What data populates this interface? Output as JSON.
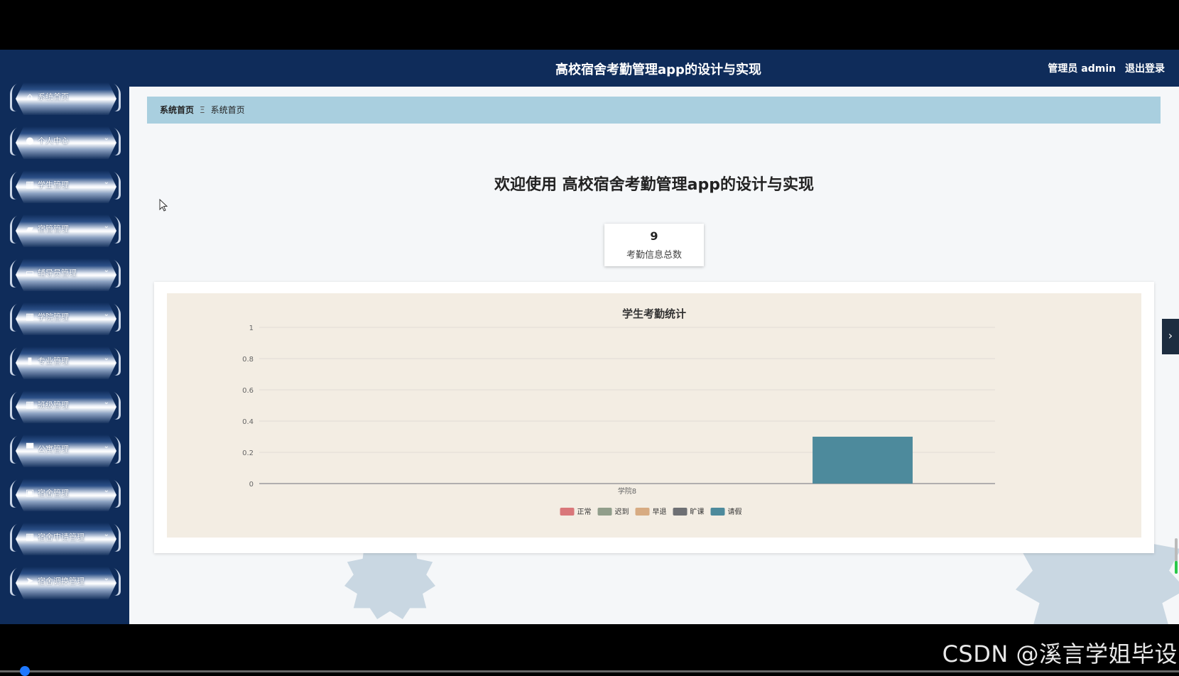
{
  "header": {
    "title": "高校宿舍考勤管理app的设计与实现",
    "user": "管理员 admin",
    "logout": "退出登录"
  },
  "sidebar": {
    "items": [
      {
        "label": "系统首页",
        "icon": "home-icon",
        "arrow": false
      },
      {
        "label": "个人中心",
        "icon": "user-icon",
        "arrow": true
      },
      {
        "label": "学生管理",
        "icon": "grid-icon",
        "arrow": true
      },
      {
        "label": "宿管管理",
        "icon": "briefcase-icon",
        "arrow": true
      },
      {
        "label": "辅导员管理",
        "icon": "monitor-icon",
        "arrow": true
      },
      {
        "label": "学院管理",
        "icon": "grid-icon",
        "arrow": true
      },
      {
        "label": "专业管理",
        "icon": "bar-chart-icon",
        "arrow": true
      },
      {
        "label": "班级管理",
        "icon": "grid-icon",
        "arrow": true
      },
      {
        "label": "公寓管理",
        "icon": "desk-icon",
        "arrow": true
      },
      {
        "label": "宿舍管理",
        "icon": "clipboard-icon",
        "arrow": true
      },
      {
        "label": "宿舍申请管理",
        "icon": "grid-icon",
        "arrow": true
      },
      {
        "label": "宿舍调换管理",
        "icon": "send-icon",
        "arrow": true
      }
    ]
  },
  "breadcrumb": {
    "home": "系统首页",
    "separator": "Ξ",
    "current": "系统首页"
  },
  "main": {
    "welcome": "欢迎使用 高校宿舍考勤管理app的设计与实现",
    "stat": {
      "value": "9",
      "label": "考勤信息总数"
    }
  },
  "watermark": "CSDN @溪言学姐毕设",
  "colors": {
    "navy": "#0f2c5a",
    "breadcrumb_bg": "#a9cfdf",
    "chart_bg": "#f3ede3"
  },
  "chart_data": {
    "type": "bar",
    "title": "学生考勤统计",
    "categories": [
      "学院8"
    ],
    "ylim": [
      0,
      1
    ],
    "yticks": [
      "0",
      "0.2",
      "0.4",
      "0.6",
      "0.8",
      "1"
    ],
    "grid": true,
    "legend_position": "bottom",
    "series": [
      {
        "name": "正常",
        "color": "#d9777a",
        "values": [
          0
        ]
      },
      {
        "name": "迟到",
        "color": "#919e8b",
        "values": [
          0
        ]
      },
      {
        "name": "早退",
        "color": "#d7ab82",
        "values": [
          0
        ]
      },
      {
        "name": "旷课",
        "color": "#6e7074",
        "values": [
          0
        ]
      },
      {
        "name": "请假",
        "color": "#4d8a9c",
        "values": [
          0.3
        ]
      }
    ]
  }
}
